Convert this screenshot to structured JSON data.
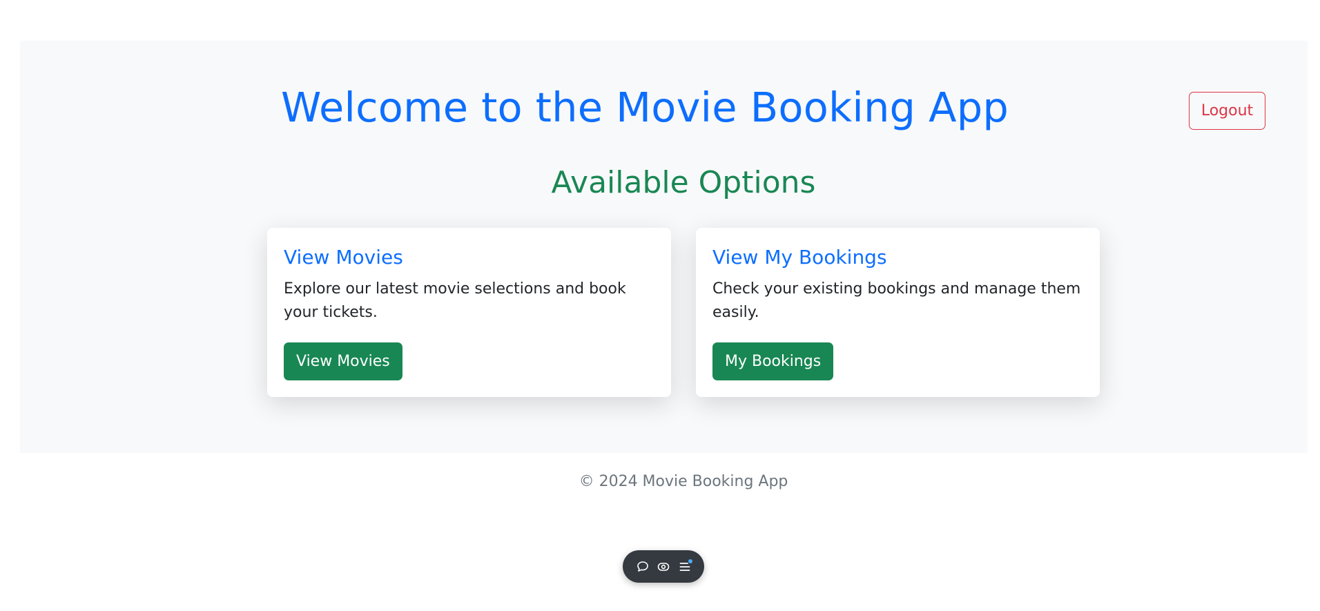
{
  "header": {
    "title": "Welcome to the Movie Booking App",
    "logout_label": "Logout"
  },
  "main": {
    "section_title": "Available Options",
    "cards": [
      {
        "title": "View Movies",
        "text": "Explore our latest movie selections and book your tickets.",
        "button_label": "View Movies"
      },
      {
        "title": "View My Bookings",
        "text": "Check your existing bookings and manage them easily.",
        "button_label": "My Bookings"
      }
    ]
  },
  "footer": {
    "text": "© 2024 Movie Booking App"
  },
  "toolbar": {
    "icons": [
      "comment-icon",
      "eye-icon",
      "menu-icon"
    ]
  },
  "colors": {
    "primary": "#0d6efd",
    "success": "#198754",
    "danger": "#dc3545",
    "panel_bg": "#f8f9fa",
    "muted": "#6c757d"
  }
}
